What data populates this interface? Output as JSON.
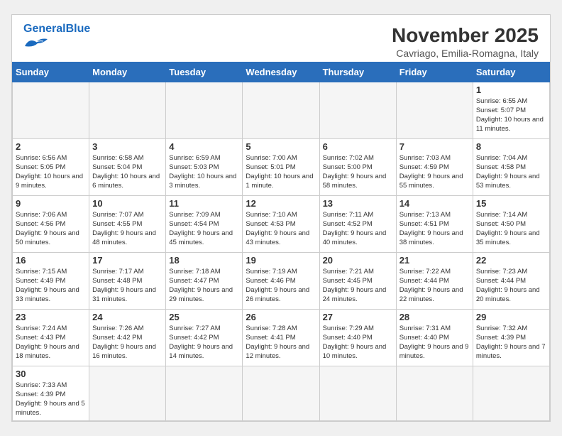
{
  "header": {
    "title": "November 2025",
    "subtitle": "Cavriago, Emilia-Romagna, Italy",
    "logo_general": "General",
    "logo_blue": "Blue"
  },
  "days_of_week": [
    "Sunday",
    "Monday",
    "Tuesday",
    "Wednesday",
    "Thursday",
    "Friday",
    "Saturday"
  ],
  "weeks": [
    [
      {
        "day": "",
        "info": ""
      },
      {
        "day": "",
        "info": ""
      },
      {
        "day": "",
        "info": ""
      },
      {
        "day": "",
        "info": ""
      },
      {
        "day": "",
        "info": ""
      },
      {
        "day": "",
        "info": ""
      },
      {
        "day": "1",
        "info": "Sunrise: 6:55 AM\nSunset: 5:07 PM\nDaylight: 10 hours and 11 minutes."
      }
    ],
    [
      {
        "day": "2",
        "info": "Sunrise: 6:56 AM\nSunset: 5:05 PM\nDaylight: 10 hours and 9 minutes."
      },
      {
        "day": "3",
        "info": "Sunrise: 6:58 AM\nSunset: 5:04 PM\nDaylight: 10 hours and 6 minutes."
      },
      {
        "day": "4",
        "info": "Sunrise: 6:59 AM\nSunset: 5:03 PM\nDaylight: 10 hours and 3 minutes."
      },
      {
        "day": "5",
        "info": "Sunrise: 7:00 AM\nSunset: 5:01 PM\nDaylight: 10 hours and 1 minute."
      },
      {
        "day": "6",
        "info": "Sunrise: 7:02 AM\nSunset: 5:00 PM\nDaylight: 9 hours and 58 minutes."
      },
      {
        "day": "7",
        "info": "Sunrise: 7:03 AM\nSunset: 4:59 PM\nDaylight: 9 hours and 55 minutes."
      },
      {
        "day": "8",
        "info": "Sunrise: 7:04 AM\nSunset: 4:58 PM\nDaylight: 9 hours and 53 minutes."
      }
    ],
    [
      {
        "day": "9",
        "info": "Sunrise: 7:06 AM\nSunset: 4:56 PM\nDaylight: 9 hours and 50 minutes."
      },
      {
        "day": "10",
        "info": "Sunrise: 7:07 AM\nSunset: 4:55 PM\nDaylight: 9 hours and 48 minutes."
      },
      {
        "day": "11",
        "info": "Sunrise: 7:09 AM\nSunset: 4:54 PM\nDaylight: 9 hours and 45 minutes."
      },
      {
        "day": "12",
        "info": "Sunrise: 7:10 AM\nSunset: 4:53 PM\nDaylight: 9 hours and 43 minutes."
      },
      {
        "day": "13",
        "info": "Sunrise: 7:11 AM\nSunset: 4:52 PM\nDaylight: 9 hours and 40 minutes."
      },
      {
        "day": "14",
        "info": "Sunrise: 7:13 AM\nSunset: 4:51 PM\nDaylight: 9 hours and 38 minutes."
      },
      {
        "day": "15",
        "info": "Sunrise: 7:14 AM\nSunset: 4:50 PM\nDaylight: 9 hours and 35 minutes."
      }
    ],
    [
      {
        "day": "16",
        "info": "Sunrise: 7:15 AM\nSunset: 4:49 PM\nDaylight: 9 hours and 33 minutes."
      },
      {
        "day": "17",
        "info": "Sunrise: 7:17 AM\nSunset: 4:48 PM\nDaylight: 9 hours and 31 minutes."
      },
      {
        "day": "18",
        "info": "Sunrise: 7:18 AM\nSunset: 4:47 PM\nDaylight: 9 hours and 29 minutes."
      },
      {
        "day": "19",
        "info": "Sunrise: 7:19 AM\nSunset: 4:46 PM\nDaylight: 9 hours and 26 minutes."
      },
      {
        "day": "20",
        "info": "Sunrise: 7:21 AM\nSunset: 4:45 PM\nDaylight: 9 hours and 24 minutes."
      },
      {
        "day": "21",
        "info": "Sunrise: 7:22 AM\nSunset: 4:44 PM\nDaylight: 9 hours and 22 minutes."
      },
      {
        "day": "22",
        "info": "Sunrise: 7:23 AM\nSunset: 4:44 PM\nDaylight: 9 hours and 20 minutes."
      }
    ],
    [
      {
        "day": "23",
        "info": "Sunrise: 7:24 AM\nSunset: 4:43 PM\nDaylight: 9 hours and 18 minutes."
      },
      {
        "day": "24",
        "info": "Sunrise: 7:26 AM\nSunset: 4:42 PM\nDaylight: 9 hours and 16 minutes."
      },
      {
        "day": "25",
        "info": "Sunrise: 7:27 AM\nSunset: 4:42 PM\nDaylight: 9 hours and 14 minutes."
      },
      {
        "day": "26",
        "info": "Sunrise: 7:28 AM\nSunset: 4:41 PM\nDaylight: 9 hours and 12 minutes."
      },
      {
        "day": "27",
        "info": "Sunrise: 7:29 AM\nSunset: 4:40 PM\nDaylight: 9 hours and 10 minutes."
      },
      {
        "day": "28",
        "info": "Sunrise: 7:31 AM\nSunset: 4:40 PM\nDaylight: 9 hours and 9 minutes."
      },
      {
        "day": "29",
        "info": "Sunrise: 7:32 AM\nSunset: 4:39 PM\nDaylight: 9 hours and 7 minutes."
      }
    ],
    [
      {
        "day": "30",
        "info": "Sunrise: 7:33 AM\nSunset: 4:39 PM\nDaylight: 9 hours and 5 minutes."
      },
      {
        "day": "",
        "info": ""
      },
      {
        "day": "",
        "info": ""
      },
      {
        "day": "",
        "info": ""
      },
      {
        "day": "",
        "info": ""
      },
      {
        "day": "",
        "info": ""
      },
      {
        "day": "",
        "info": ""
      }
    ]
  ]
}
